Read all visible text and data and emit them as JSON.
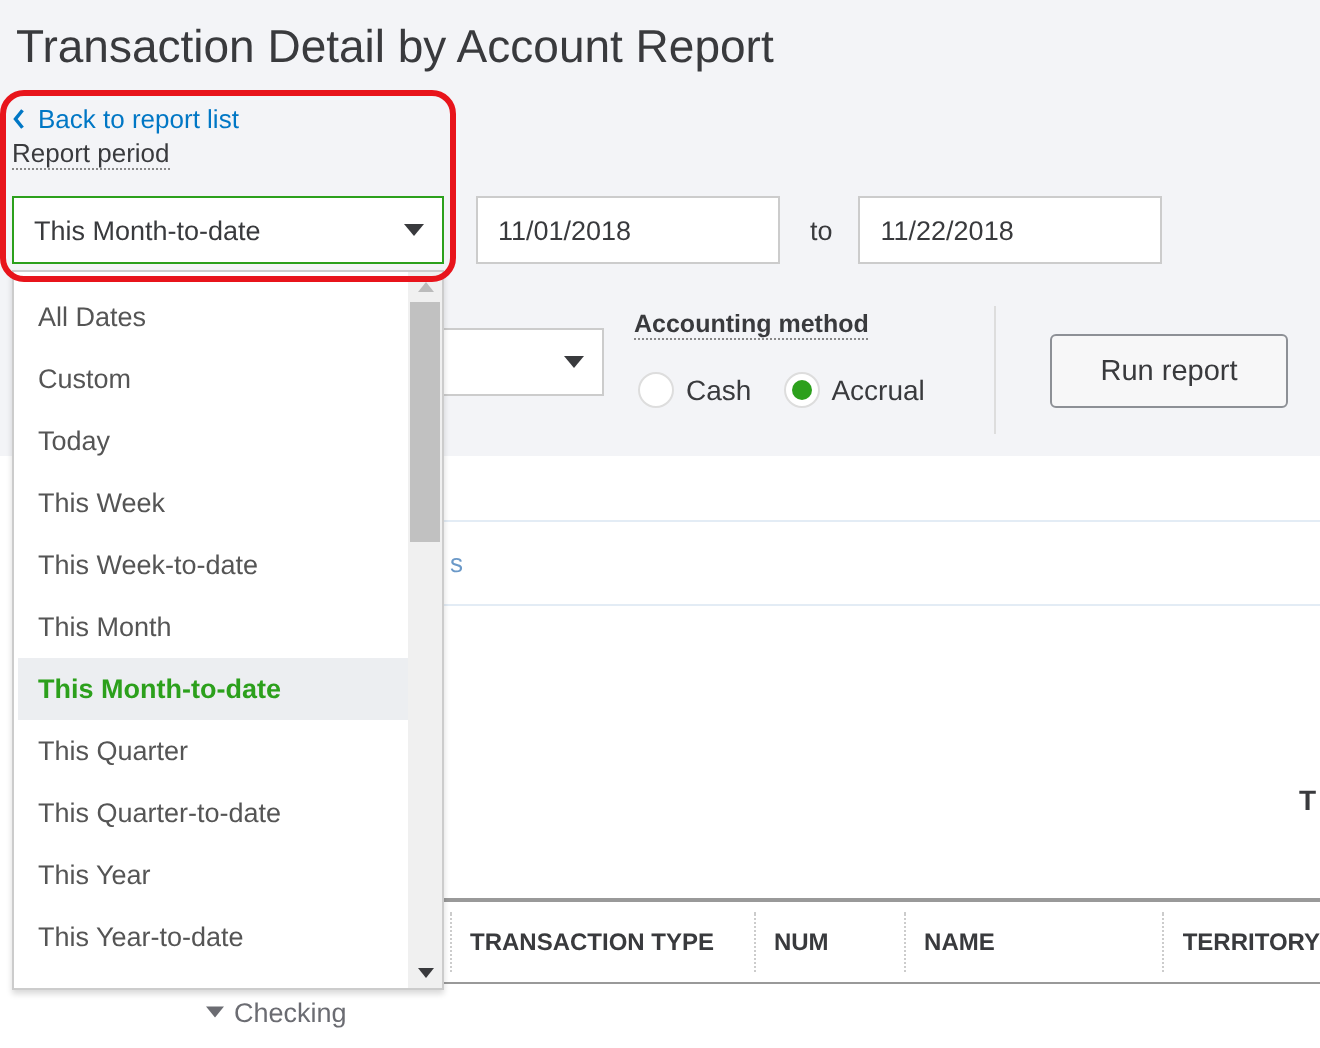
{
  "title": "Transaction Detail by Account Report",
  "back_link": "Back to report list",
  "report_period": {
    "label": "Report period",
    "value": "This Month-to-date"
  },
  "date_from": "11/01/2018",
  "date_separator": "to",
  "date_to": "11/22/2018",
  "accounting_method": {
    "label": "Accounting method",
    "options": [
      {
        "label": "Cash",
        "selected": false
      },
      {
        "label": "Accrual",
        "selected": true
      }
    ]
  },
  "run_button": "Run report",
  "link_fragment": "s",
  "heading_fragment": "T",
  "table": {
    "columns": [
      "TRANSACTION TYPE",
      "NUM",
      "NAME",
      "TERRITORY"
    ],
    "rows": [
      {
        "label": "Checking",
        "expanded": true
      }
    ]
  },
  "dropdown": {
    "items": [
      {
        "label": "All Dates",
        "selected": false
      },
      {
        "label": "Custom",
        "selected": false
      },
      {
        "label": "Today",
        "selected": false
      },
      {
        "label": "This Week",
        "selected": false
      },
      {
        "label": "This Week-to-date",
        "selected": false
      },
      {
        "label": "This Month",
        "selected": false
      },
      {
        "label": "This Month-to-date",
        "selected": true
      },
      {
        "label": "This Quarter",
        "selected": false
      },
      {
        "label": "This Quarter-to-date",
        "selected": false
      },
      {
        "label": "This Year",
        "selected": false
      },
      {
        "label": "This Year-to-date",
        "selected": false
      }
    ]
  }
}
